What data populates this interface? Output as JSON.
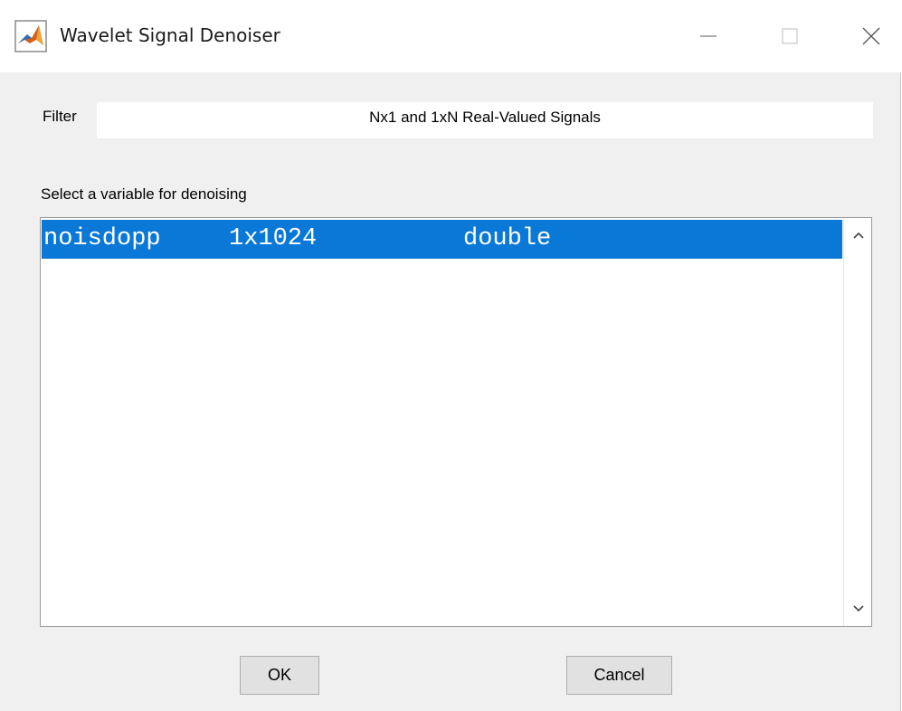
{
  "window": {
    "title": "Wavelet Signal Denoiser",
    "icon": "matlab-icon",
    "controls": [
      "minimize-icon",
      "maximize-icon",
      "close-icon"
    ]
  },
  "filter": {
    "label": "Filter",
    "value": "Nx1 and 1xN Real-Valued Signals"
  },
  "variables": {
    "label": "Select a variable for denoising",
    "items": [
      {
        "name": "noisdopp",
        "size": "1x1024",
        "class": "double",
        "selected": true
      }
    ]
  },
  "buttons": {
    "ok": "OK",
    "cancel": "Cancel"
  },
  "colors": {
    "selection": "#0a78d7",
    "background": "#f0f0f0"
  }
}
